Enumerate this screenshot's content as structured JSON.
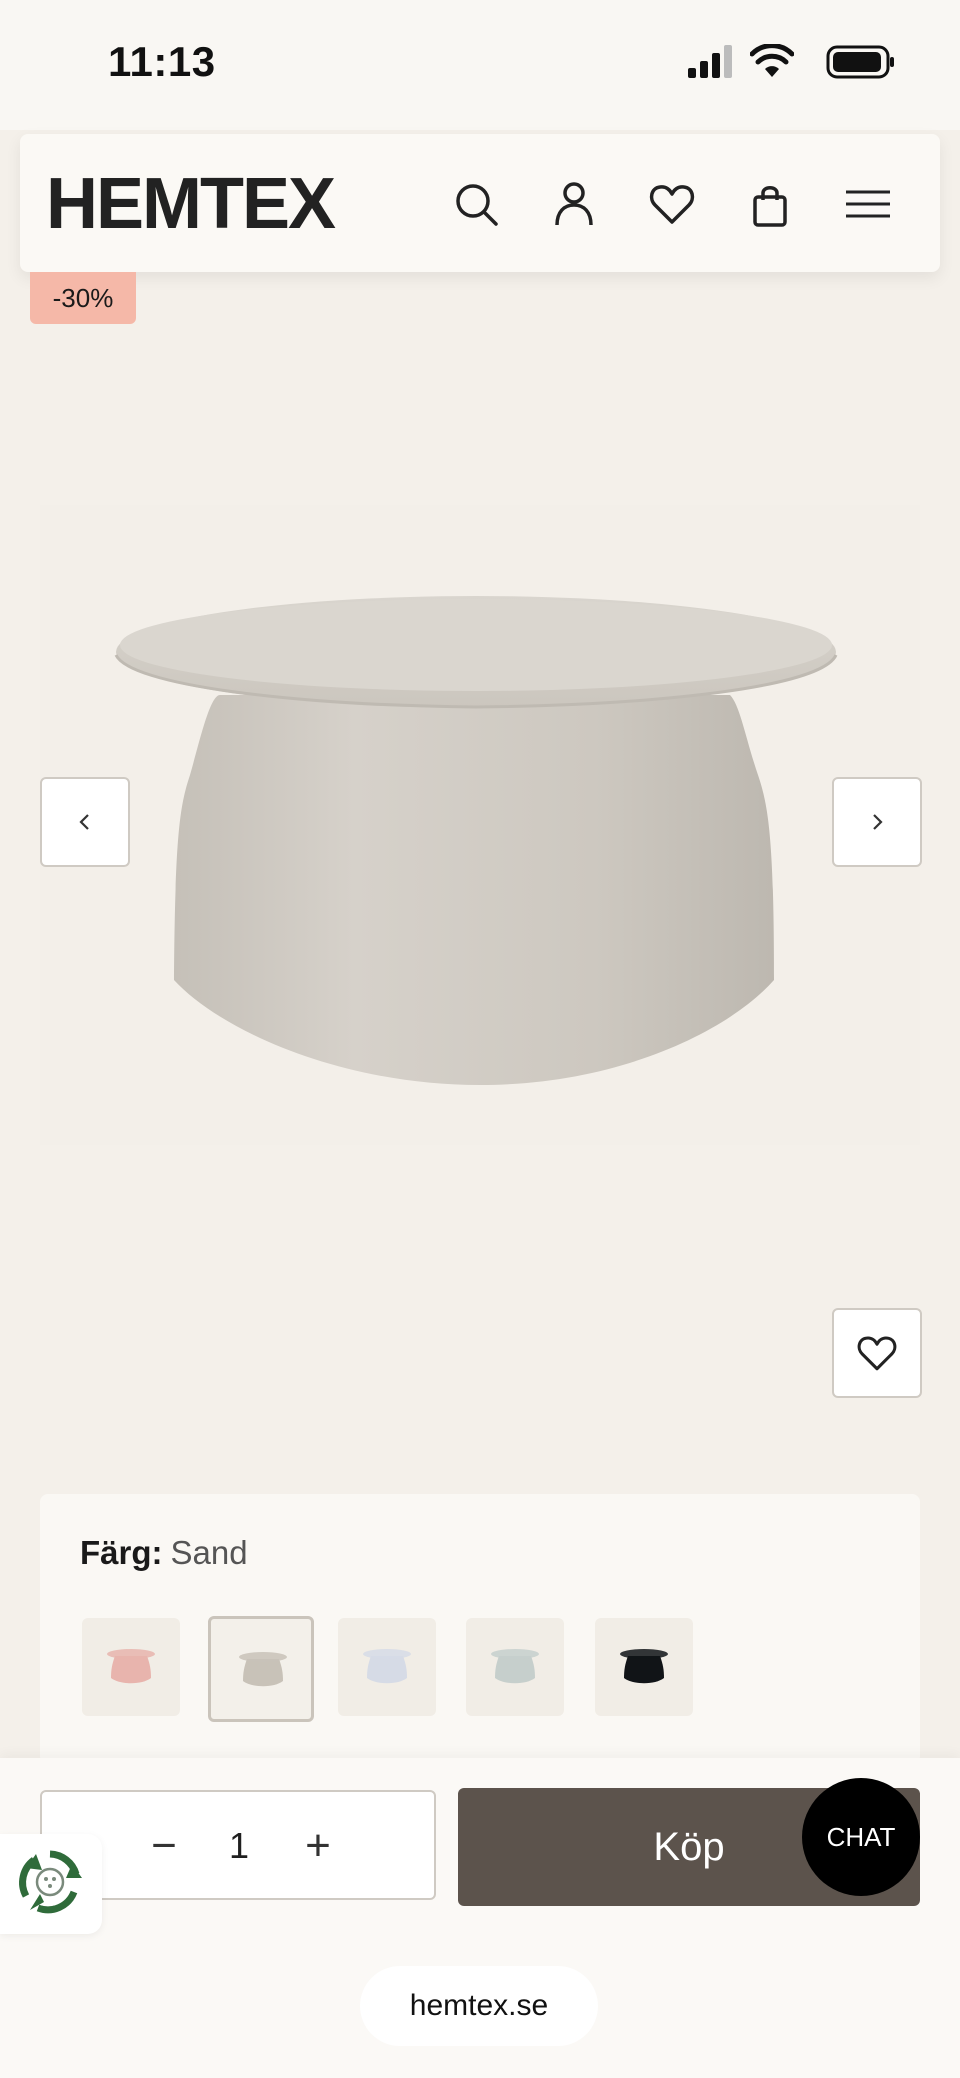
{
  "status_bar": {
    "time": "11:13"
  },
  "header": {
    "logo": "HEMTEX",
    "icons": [
      "search-icon",
      "user-icon",
      "heart-icon",
      "bag-icon",
      "menu-icon"
    ]
  },
  "product": {
    "discount_badge": "-30%",
    "image_alt": "table",
    "color_label": "Färg:",
    "color_value": "Sand",
    "swatches": [
      {
        "color": "#e8b4ad"
      },
      {
        "color": "#c8c2b8",
        "selected": true
      },
      {
        "color": "#d6dbe6"
      },
      {
        "color": "#c6cfcc"
      },
      {
        "color": "#111417"
      }
    ]
  },
  "purchase": {
    "quantity": "1",
    "minus_label": "−",
    "plus_label": "+",
    "buy_label": "Köp",
    "chat_label": "CHAT"
  },
  "browser": {
    "url": "hemtex.se"
  },
  "colors": {
    "background": "#f4f0ea",
    "buy_button": "#5c534c",
    "badge": "#f5b8a8"
  }
}
